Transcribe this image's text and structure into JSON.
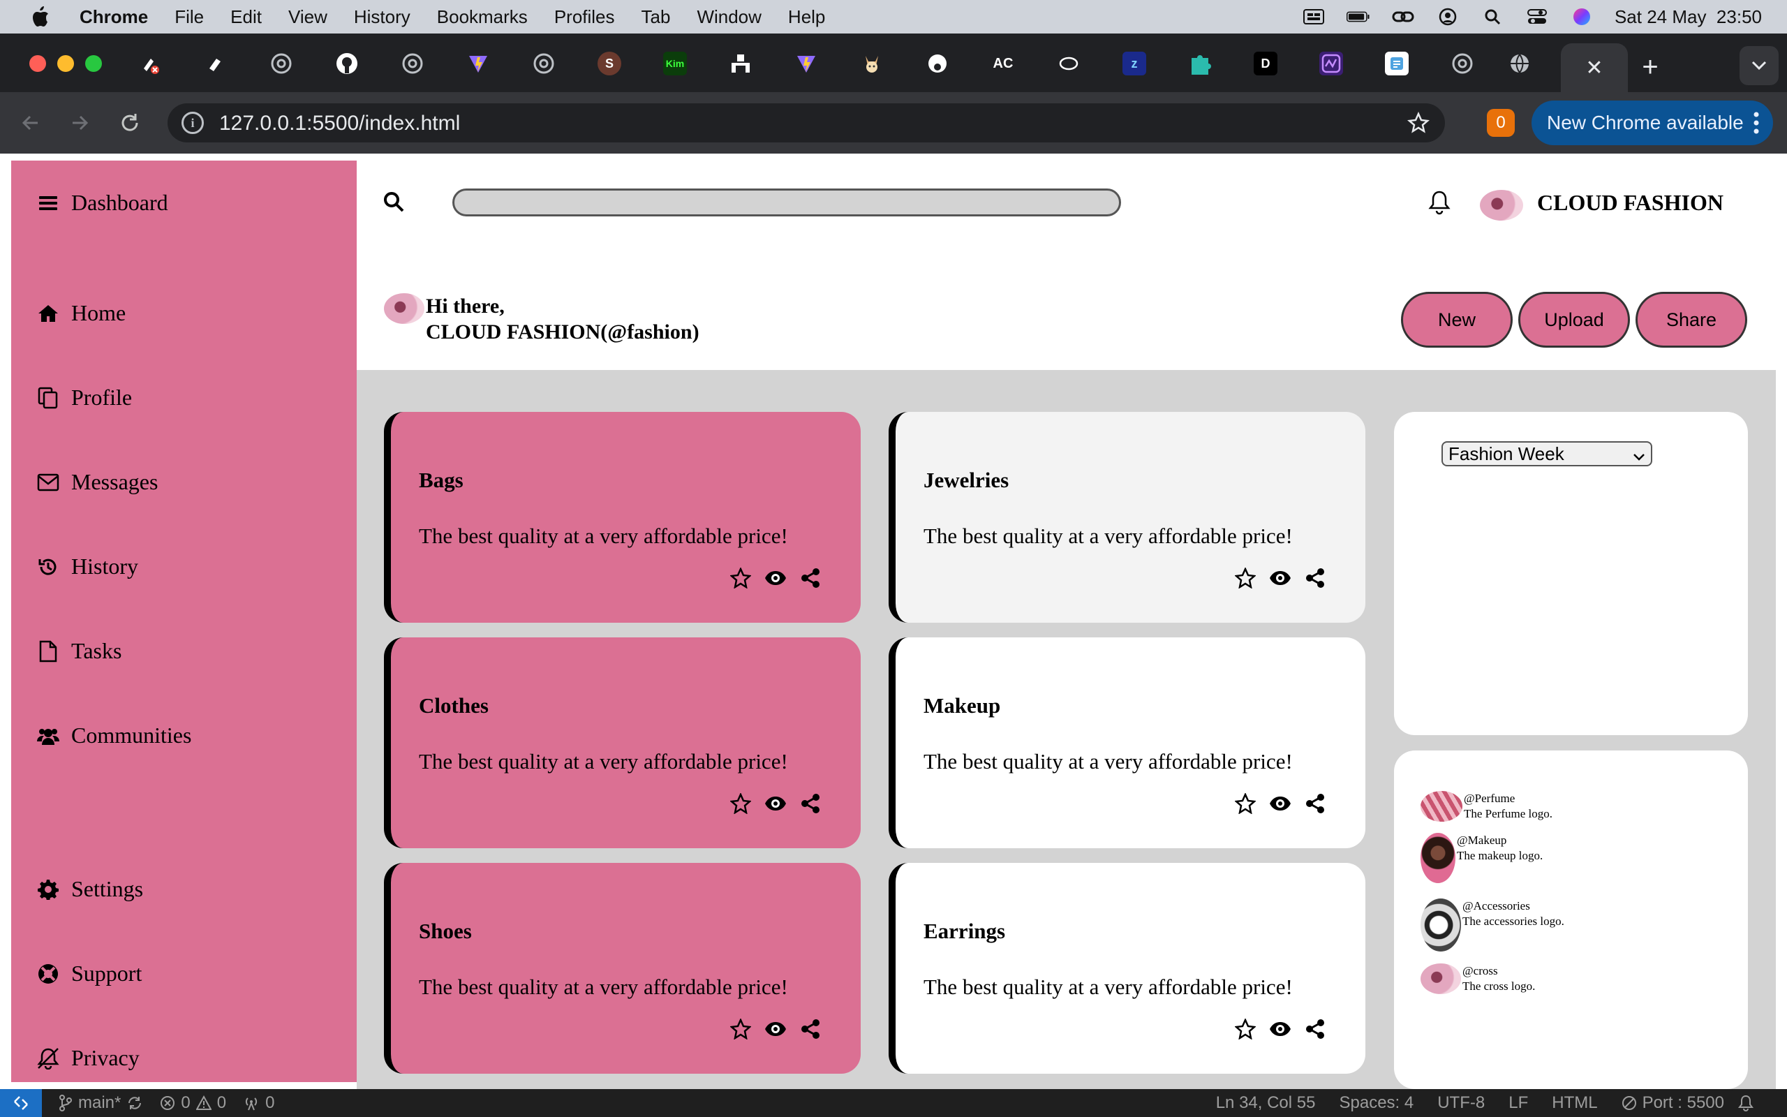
{
  "menubar": {
    "app_name": "Chrome",
    "items": [
      "File",
      "Edit",
      "View",
      "History",
      "Bookmarks",
      "Profiles",
      "Tab",
      "Window",
      "Help"
    ],
    "datetime": "Sat 24 May  23:50"
  },
  "browser": {
    "extension_badge": "0",
    "address": "127.0.0.1:5500/index.html",
    "update_label": "New Chrome available",
    "close_tab_glyph": "✕",
    "new_tab_glyph": "+",
    "tab_favicon_labels": {
      "s": "S",
      "kim": "Kim",
      "ac": "AC",
      "zz": "z",
      "d": "D"
    }
  },
  "sidebar": {
    "title": "Dashboard",
    "items": [
      {
        "label": "Home",
        "icon": "home-icon"
      },
      {
        "label": "Profile",
        "icon": "copy-icon"
      },
      {
        "label": "Messages",
        "icon": "envelope-icon"
      },
      {
        "label": "History",
        "icon": "history-icon"
      },
      {
        "label": "Tasks",
        "icon": "file-icon"
      },
      {
        "label": "Communities",
        "icon": "users-icon"
      }
    ],
    "bottom_items": [
      {
        "label": "Settings",
        "icon": "gear-icon"
      },
      {
        "label": "Support",
        "icon": "lifebuoy-icon"
      },
      {
        "label": "Privacy",
        "icon": "bell-slash-icon"
      }
    ]
  },
  "header": {
    "search_value": "",
    "brand": "CLOUD FASHION"
  },
  "greeting": {
    "line1": "Hi there,",
    "line2": "CLOUD FASHION(@fashion)"
  },
  "actions": [
    "New",
    "Upload",
    "Share"
  ],
  "cards": [
    {
      "title": "Bags",
      "text": "The best quality at a very affordable price!"
    },
    {
      "title": "Jewelries",
      "text": "The best quality at a very affordable price!"
    },
    {
      "title": "Clothes",
      "text": "The best quality at a very affordable price!"
    },
    {
      "title": "Makeup",
      "text": "The best quality at a very affordable price!"
    },
    {
      "title": "Shoes",
      "text": "The best quality at a very affordable price!"
    },
    {
      "title": "Earrings",
      "text": "The best quality at a very affordable price!"
    }
  ],
  "filter": {
    "selected": "Fashion Week"
  },
  "accounts": [
    {
      "handle": "@Perfume",
      "desc": "The Perfume logo."
    },
    {
      "handle": "@Makeup",
      "desc": "The makeup logo."
    },
    {
      "handle": "@Accessories",
      "desc": "The accessories logo."
    },
    {
      "handle": "@cross",
      "desc": "The cross logo."
    }
  ],
  "statusbar": {
    "branch": "main*",
    "errors": "0",
    "warnings": "0",
    "ports": "0",
    "cursor": "Ln 34, Col 55",
    "spaces": "Spaces: 4",
    "encoding": "UTF-8",
    "eol": "LF",
    "language": "HTML",
    "port": "Port : 5500"
  },
  "colors": {
    "accent_pink": "#db7093",
    "content_gray": "#d3d3d3",
    "chrome_dark": "#202124",
    "update_blue": "#0b5394"
  }
}
